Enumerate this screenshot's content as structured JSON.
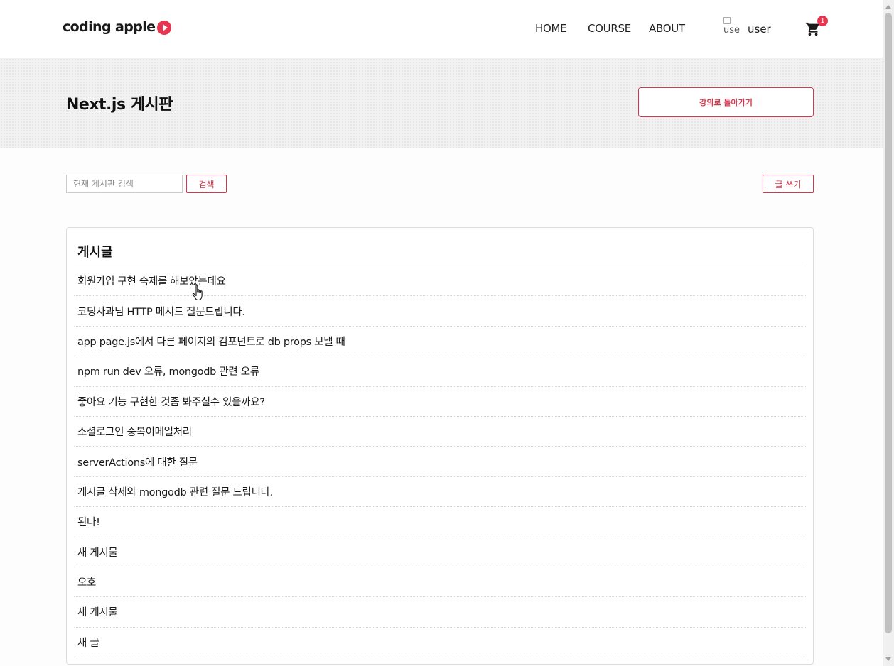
{
  "header": {
    "logo_text": "coding apple",
    "nav": {
      "home": "HOME",
      "course": "COURSE",
      "about": "ABOUT"
    },
    "avatar_alt": "use",
    "user_name": "user",
    "cart_count": "1",
    "accent_color": "#e8344e"
  },
  "banner": {
    "title": "Next.js 게시판",
    "back_button": "강의로 돌아가기"
  },
  "toolbar": {
    "search_placeholder": "현재 게시판 검색",
    "search_button": "검색",
    "write_button": "글 쓰기"
  },
  "posts": {
    "heading": "게시글",
    "items": [
      "회원가입 구현 숙제를 해보았는데요",
      "코딩사과님 HTTP 메서드 질문드립니다.",
      "app page.js에서 다른 페이지의 컴포넌트로 db props 보낼 때",
      "npm run dev 오류, mongodb 관련 오류",
      "좋아요 기능 구현한 것좀 봐주실수 있을까요?",
      "소셜로그인 중복이메일처리",
      "serverActions에 대한 질문",
      "게시글 삭제와 mongodb 관련 질문 드립니다.",
      "된다!",
      "새 게시물",
      "오호",
      "새 게시물",
      "새 글"
    ]
  }
}
